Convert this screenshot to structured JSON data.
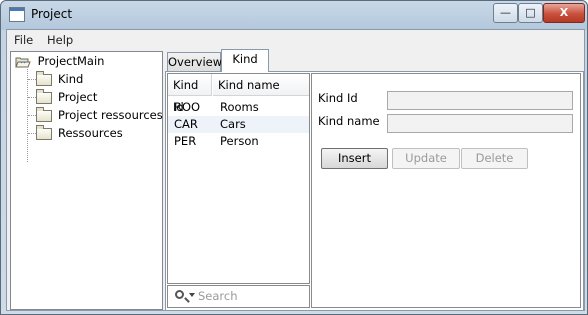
{
  "window": {
    "title": "Project",
    "controls": {
      "minimize": "—",
      "maximize": "□",
      "close": "X"
    }
  },
  "menu": [
    "File",
    "Help"
  ],
  "tree": {
    "root": "ProjectMain",
    "items": [
      {
        "label": "Kind",
        "selected": true
      },
      {
        "label": "Project",
        "selected": false
      },
      {
        "label": "Project ressources",
        "selected": false
      },
      {
        "label": "Ressources",
        "selected": false
      }
    ]
  },
  "tabs": [
    {
      "label": "Overview",
      "active": false
    },
    {
      "label": "Kind",
      "active": true
    }
  ],
  "table": {
    "columns": [
      "Kind Id",
      "Kind name"
    ],
    "rows": [
      [
        "ROO",
        "Rooms"
      ],
      [
        "CAR",
        "Cars"
      ],
      [
        "PER",
        "Person"
      ]
    ]
  },
  "search": {
    "placeholder": "Search"
  },
  "form": {
    "fields": [
      {
        "label": "Kind Id",
        "value": ""
      },
      {
        "label": "Kind name",
        "value": ""
      }
    ],
    "buttons": [
      {
        "label": "Insert",
        "enabled": true
      },
      {
        "label": "Update",
        "enabled": false
      },
      {
        "label": "Delete",
        "enabled": false
      }
    ]
  },
  "colors": {
    "title_gradient": "#c8d8e8",
    "close_button": "#c8503c",
    "selected_row_alt": "#eef3fa",
    "disabled_text": "#9a9a9a"
  }
}
